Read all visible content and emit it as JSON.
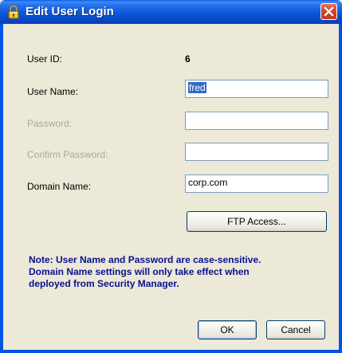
{
  "window": {
    "title": "Edit User Login",
    "title_icon": "lock-icon",
    "close_icon": "close-icon"
  },
  "form": {
    "user_id": {
      "label": "User ID:",
      "value": "6"
    },
    "user_name": {
      "label": "User Name:",
      "value": "fred",
      "selected": true
    },
    "password": {
      "label": "Password:",
      "value": "",
      "disabled": true
    },
    "confirm_password": {
      "label": "Confirm Password:",
      "value": "",
      "disabled": true
    },
    "domain_name": {
      "label": "Domain Name:",
      "value": "corp.com"
    }
  },
  "buttons": {
    "ftp_access": "FTP Access...",
    "ok": "OK",
    "cancel": "Cancel"
  },
  "note": {
    "lines": [
      "Note: User Name and Password are case-sensitive.",
      "Domain Name settings will only take effect when",
      "deployed from Security Manager."
    ]
  },
  "colors": {
    "titlebar": "#0a57d8",
    "dialog_background": "#ece9d8",
    "note_text": "#0a1090",
    "disabled_text": "#aca899",
    "selection": "#316ac5"
  }
}
